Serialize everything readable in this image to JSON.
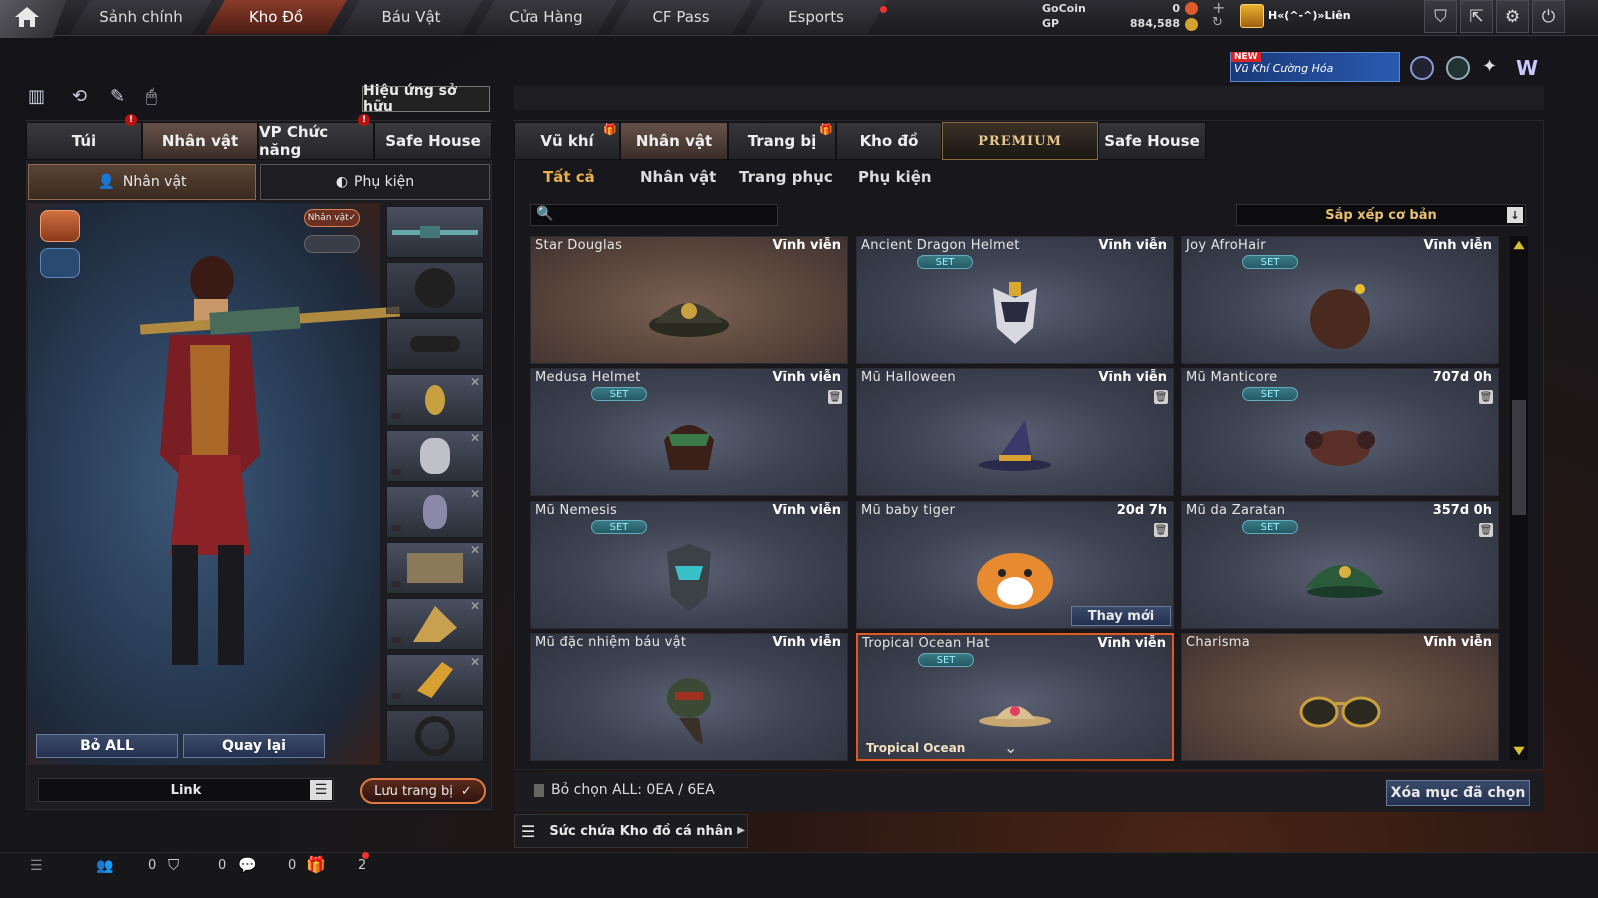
{
  "topnav": {
    "tabs": [
      "Sảnh chính",
      "Kho Đồ",
      "Báu Vật",
      "Cửa Hàng",
      "CF Pass",
      "Esports"
    ],
    "active": 1
  },
  "currency": {
    "gocoin_label": "GoCoin",
    "gocoin_value": "0",
    "gp_label": "GP",
    "gp_value": "884,588"
  },
  "player": {
    "name": "H«(^-^)»Liên"
  },
  "promo": {
    "badge": "NEW",
    "text": "Vũ Khí Cường Hóa"
  },
  "left": {
    "effects_button": "Hiệu ứng sở hữu",
    "tabs": [
      "Túi",
      "Nhân vật",
      "VP Chức năng",
      "Safe House"
    ],
    "subtabs": [
      "Nhân vật",
      "Phụ kiện"
    ],
    "char_badge": "Nhân vật",
    "btn_remove_all": "Bỏ ALL",
    "btn_back": "Quay lại",
    "link_label": "Link",
    "save_btn": "Lưu trang bị"
  },
  "right": {
    "tabs": [
      "Vũ khí",
      "Nhân vật",
      "Trang bị",
      "Kho đồ",
      "PREMIUM",
      "Safe House"
    ],
    "filters": [
      "Tất cả",
      "Nhân vật",
      "Trang phục",
      "Phụ kiện"
    ],
    "sort_label": "Sắp xếp cơ bản",
    "search_placeholder": "",
    "items": [
      {
        "name": "Star Douglas",
        "duration": "Vĩnh viễn",
        "set": false,
        "trash": false,
        "brown": true,
        "art": "cap"
      },
      {
        "name": "Ancient Dragon Helmet",
        "duration": "Vĩnh viễn",
        "set": true,
        "trash": false,
        "brown": false,
        "art": "dragon"
      },
      {
        "name": "Joy AfroHair",
        "duration": "Vĩnh viễn",
        "set": true,
        "trash": false,
        "brown": false,
        "art": "afro"
      },
      {
        "name": "Medusa Helmet",
        "duration": "Vĩnh viễn",
        "set": true,
        "trash": true,
        "brown": false,
        "art": "medusa"
      },
      {
        "name": "Mũ Halloween",
        "duration": "Vĩnh viễn",
        "set": false,
        "trash": true,
        "brown": false,
        "art": "witch"
      },
      {
        "name": "Mũ Manticore",
        "duration": "707d 0h",
        "set": true,
        "trash": true,
        "brown": false,
        "art": "manticore"
      },
      {
        "name": "Mũ Nemesis",
        "duration": "Vĩnh viễn",
        "set": true,
        "trash": false,
        "brown": false,
        "art": "nemesis"
      },
      {
        "name": "Mũ baby tiger",
        "duration": "20d 7h",
        "set": false,
        "trash": true,
        "brown": false,
        "art": "tiger"
      },
      {
        "name": "Mũ da Zaratan",
        "duration": "357d 0h",
        "set": true,
        "trash": true,
        "brown": false,
        "art": "zaratan"
      },
      {
        "name": "Mũ đặc nhiệm báu vật",
        "duration": "Vĩnh viễn",
        "set": false,
        "trash": false,
        "brown": false,
        "art": "spec"
      },
      {
        "name": "Tropical Ocean Hat",
        "duration": "Vĩnh viễn",
        "set": true,
        "trash": false,
        "brown": false,
        "art": "tropical"
      },
      {
        "name": "Charisma",
        "duration": "Vĩnh viễn",
        "set": false,
        "trash": false,
        "brown": true,
        "art": "glasses"
      }
    ],
    "replace_btn": "Thay mới",
    "selected_footer": "Tropical Ocean",
    "deselect_text": "Bỏ chọn ALL: 0EA / 6EA",
    "delete_btn": "Xóa mục đã chọn",
    "capacity_label": "Sức chứa Kho đồ cá nhân"
  },
  "bottombar": {
    "count1": "0",
    "count2": "0",
    "count3": "0",
    "count4": "2"
  }
}
